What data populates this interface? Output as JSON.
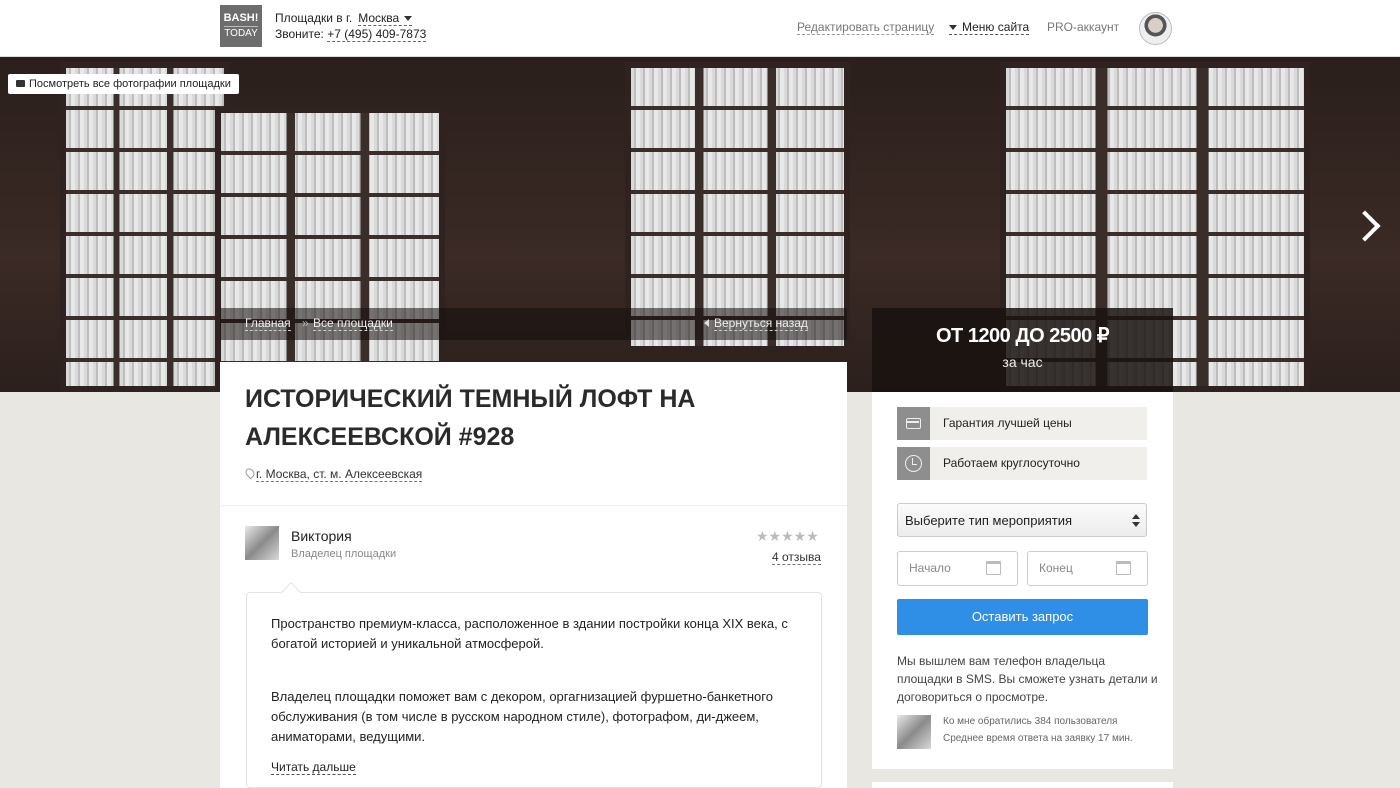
{
  "header": {
    "logo_line1": "BASH!",
    "logo_line2": "TODAY",
    "city_prefix": "Площадки в г.",
    "city": "Москва",
    "phone_prefix": "Звоните:",
    "phone": "+7 (495) 409-7873",
    "edit_page": "Редактировать страницу",
    "site_menu": "Меню сайта",
    "pro_account": "PRO-аккаунт"
  },
  "hero": {
    "photos_button": "Посмотреть все фотографии площадки",
    "breadcrumb": [
      "Главная",
      "Все площадки"
    ],
    "breadcrumb_separator": "»",
    "back_link": "Вернуться назад",
    "price": "ОТ 1200 ДО 2500 ₽",
    "price_unit": "за час"
  },
  "venue": {
    "title": "ИСТОРИЧЕСКИЙ ТЕМНЫЙ ЛОФТ НА АЛЕКСЕЕВСКОЙ #928",
    "address": "г. Москва, ст. м. Алексеевская"
  },
  "owner": {
    "name": "Виктория",
    "role": "Владелец площадки",
    "stars": "★★★★★",
    "reviews": "4 отзыва"
  },
  "description": {
    "p1": "Пространство премиум-класса, расположенное в здании постройки конца XIX века, с богатой историей и уникальной атмосферой.",
    "p2": "Владелец площадки поможет вам с декором, оргагнизацией фуршетно-банкетного обслуживания (в том числе в русском народном стиле), фотографом, ди-джеем, аниматорами, ведущими.",
    "read_more": "Читать дальше"
  },
  "booking": {
    "features": [
      "Гарантия лучшей цены",
      "Работаем круглосуточно"
    ],
    "event_type_selected": "Выберите тип мероприятия",
    "start_placeholder": "Начало",
    "end_placeholder": "Конец",
    "submit": "Оставить запрос",
    "sms_note": "Мы вышлем вам телефон владельца площадки в SMS. Вы сможете узнать детали и договориться о просмотре.",
    "stat_users": "Ко мне обратились 384 пользователя",
    "stat_response": "Среднее время ответа на заявку 17 мин."
  },
  "colors": {
    "accent_button": "#2f8ee6",
    "page_background": "#e8e7e2",
    "hero_overlay": "#19120f"
  }
}
